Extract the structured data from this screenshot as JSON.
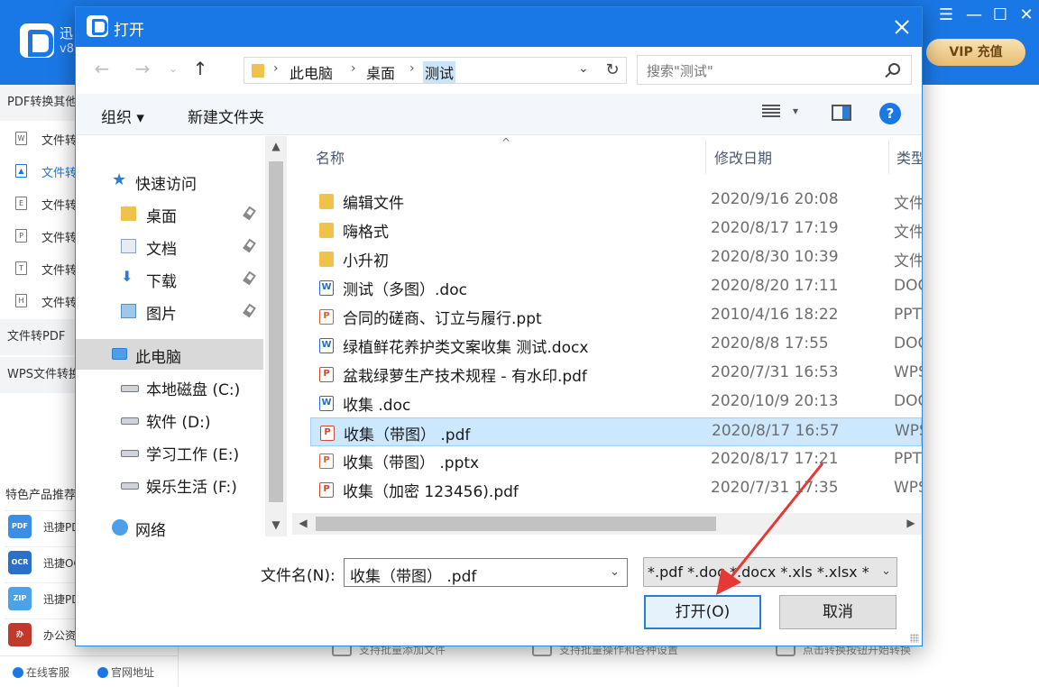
{
  "app": {
    "title": "迅",
    "version": "v8",
    "vip_label": "VIP 充值",
    "sidebar_sections": [
      "PDF转换其他",
      "文件转PDF",
      "WPS文件转换"
    ],
    "sidebar_items": [
      {
        "icon": "W",
        "label": "文件转"
      },
      {
        "icon": "▲",
        "label": "文件转"
      },
      {
        "icon": "E",
        "label": "文件转"
      },
      {
        "icon": "P",
        "label": "文件转"
      },
      {
        "icon": "T",
        "label": "文件转"
      },
      {
        "icon": "H",
        "label": "文件转"
      }
    ],
    "featured_title": "特色产品推荐",
    "featured": [
      {
        "icon_label": "PDF",
        "label": "迅捷PD",
        "color": "#3a8ee6"
      },
      {
        "icon_label": "OCR",
        "label": "迅捷OC",
        "color": "#2a6fc9"
      },
      {
        "icon_label": "ZIP",
        "label": "迅捷PD",
        "color": "#4aa3e8"
      },
      {
        "icon_label": "办",
        "label": "办公资",
        "color": "#c0392b"
      }
    ],
    "footer": {
      "service": "在线客服",
      "site": "官网地址"
    },
    "hints": [
      "支持批量添加文件",
      "支持批量操作和各种设置",
      "点击转换按钮开始转换"
    ]
  },
  "dialog": {
    "title": "打开",
    "breadcrumb": [
      "此电脑",
      "桌面",
      "测试"
    ],
    "search_placeholder": "搜索\"测试\"",
    "toolbar": {
      "organize": "组织 ▾",
      "new_folder": "新建文件夹",
      "help": "?"
    },
    "nav_tree": [
      {
        "icon": "star",
        "label": "快速访问",
        "indent": 1,
        "pinned": false
      },
      {
        "icon": "folder",
        "label": "桌面",
        "indent": 2,
        "pinned": true
      },
      {
        "icon": "doc",
        "label": "文档",
        "indent": 2,
        "pinned": true
      },
      {
        "icon": "down",
        "label": "下载",
        "indent": 2,
        "pinned": true
      },
      {
        "icon": "pic",
        "label": "图片",
        "indent": 2,
        "pinned": true
      },
      {
        "icon": "pc",
        "label": "此电脑",
        "indent": 1,
        "pinned": false,
        "selected": true
      },
      {
        "icon": "drive",
        "label": "本地磁盘 (C:)",
        "indent": 2,
        "pinned": false
      },
      {
        "icon": "drive",
        "label": "软件 (D:)",
        "indent": 2,
        "pinned": false
      },
      {
        "icon": "drive",
        "label": "学习工作 (E:)",
        "indent": 2,
        "pinned": false
      },
      {
        "icon": "drive",
        "label": "娱乐生活 (F:)",
        "indent": 2,
        "pinned": false
      },
      {
        "icon": "net",
        "label": "网络",
        "indent": 1,
        "pinned": false
      }
    ],
    "columns": {
      "name": "名称",
      "date": "修改日期",
      "type": "类型"
    },
    "files": [
      {
        "kind": "folder",
        "name": "编辑文件",
        "date": "2020/9/16 20:08",
        "type": "文件夹"
      },
      {
        "kind": "folder",
        "name": "嗨格式",
        "date": "2020/8/17 17:19",
        "type": "文件夹"
      },
      {
        "kind": "folder",
        "name": "小升初",
        "date": "2020/8/30 10:39",
        "type": "文件夹"
      },
      {
        "kind": "word",
        "name": "测试（多图）.doc",
        "date": "2020/8/20 17:11",
        "type": "DOC"
      },
      {
        "kind": "ppt",
        "name": "合同的磋商、订立与履行.ppt",
        "date": "2010/4/16 18:22",
        "type": "PPT"
      },
      {
        "kind": "word",
        "name": "绿植鲜花养护类文案收集 测试.docx",
        "date": "2020/8/8 17:55",
        "type": "DOC"
      },
      {
        "kind": "pdf",
        "name": "盆栽绿萝生产技术规程 - 有水印.pdf",
        "date": "2020/7/31 16:53",
        "type": "WPS"
      },
      {
        "kind": "word",
        "name": "收集 .doc",
        "date": "2020/10/9 20:13",
        "type": "DOC"
      },
      {
        "kind": "pdf",
        "name": "收集（带图） .pdf",
        "date": "2020/8/17 16:57",
        "type": "WPS",
        "selected": true
      },
      {
        "kind": "ppt",
        "name": "收集（带图） .pptx",
        "date": "2020/8/17 17:21",
        "type": "PPT"
      },
      {
        "kind": "pdf",
        "name": "收集（加密 123456).pdf",
        "date": "2020/7/31 17:35",
        "type": "WPS"
      }
    ],
    "filename_label": "文件名(N):",
    "filename_value": "收集（带图） .pdf",
    "filetype_value": "*.pdf *.doc *.docx *.xls *.xlsx *",
    "open_button": "打开(O)",
    "cancel_button": "取消"
  },
  "colors": {
    "accent": "#1a78e6",
    "selection": "#cce8ff",
    "annotation_arrow": "#e53935"
  }
}
